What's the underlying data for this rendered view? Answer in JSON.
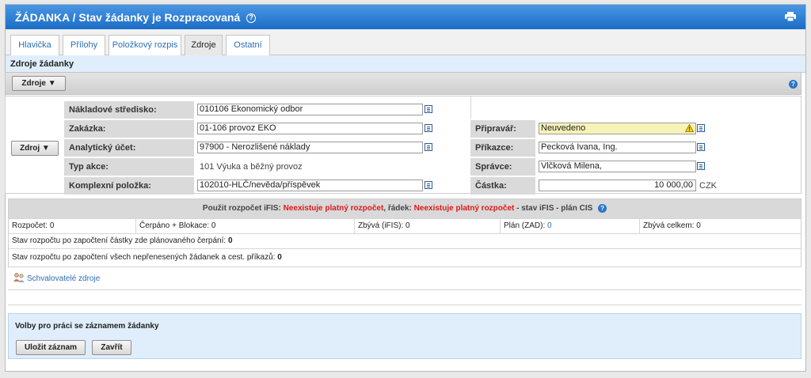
{
  "header": {
    "title": "ŽÁDANKA / Stav žádanky je Rozpracovaná",
    "help_glyph": "?",
    "print_icon": "printer-icon"
  },
  "tabs": [
    {
      "label": "Hlavička"
    },
    {
      "label": "Přílohy"
    },
    {
      "label": "Položkový rozpis"
    },
    {
      "label": "Zdroje"
    },
    {
      "label": "Ostatní"
    }
  ],
  "active_tab": "Zdroje",
  "section": {
    "title": "Zdroje žádanky"
  },
  "toolbar": {
    "zdroje_button": "Zdroje ▼",
    "help_glyph": "?"
  },
  "form": {
    "zdroj_button": "Zdroj ▼",
    "left_fields": [
      {
        "label": "Nákladové středisko:",
        "value": "010106 Ekonomický odbor"
      },
      {
        "label": "Zakázka:",
        "value": "01-106 provoz EKO"
      },
      {
        "label": "Analytický účet:",
        "value": "97900 - Nerozlišené náklady"
      },
      {
        "label": "Typ akce:",
        "value": "101 Výuka a běžný provoz"
      },
      {
        "label": "Komplexní položka:",
        "value": "102010-HLČ/nevěda/příspěvek"
      }
    ],
    "right_fields": [
      {
        "label": "Připravář:",
        "value": "Neuvedeno"
      },
      {
        "label": "Příkazce:",
        "value": "Pecková Ivana, Ing."
      },
      {
        "label": "Správce:",
        "value": "Vlčková Milena,"
      },
      {
        "label": "Částka:",
        "value": "10 000,00"
      }
    ],
    "currency": "CZK"
  },
  "budget": {
    "heading_prefix": "Použit rozpočet iFIS:",
    "heading_red1": "Neexistuje platný rozpočet",
    "heading_mid": ", řádek:",
    "heading_red2": "Neexistuje platný rozpočet",
    "heading_suffix": "- stav iFIS - plán CIS",
    "help_glyph": "?",
    "cells": [
      {
        "label": "Rozpočet:",
        "value": "0"
      },
      {
        "label": "Čerpáno + Blokace:",
        "value": "0"
      },
      {
        "label": "Zbývá (iFIS):",
        "value": "0"
      },
      {
        "label": "Plán (ZAD):",
        "value": "0"
      },
      {
        "label": "Zbývá celkem:",
        "value": "0"
      }
    ],
    "row2_label": "Stav rozpočtu po započtení částky zde plánovaného čerpání:",
    "row2_value": "0",
    "row3_label": "Stav rozpočtu po započtení všech nepřenesených žádanek a cest. příkazů:",
    "row3_value": "0"
  },
  "approvers": {
    "label": "Schvalovatelé zdroje"
  },
  "options": {
    "title": "Volby pro práci se záznamem žádanky",
    "save_button": "Uložit záznam",
    "close_button": "Zavřít"
  }
}
